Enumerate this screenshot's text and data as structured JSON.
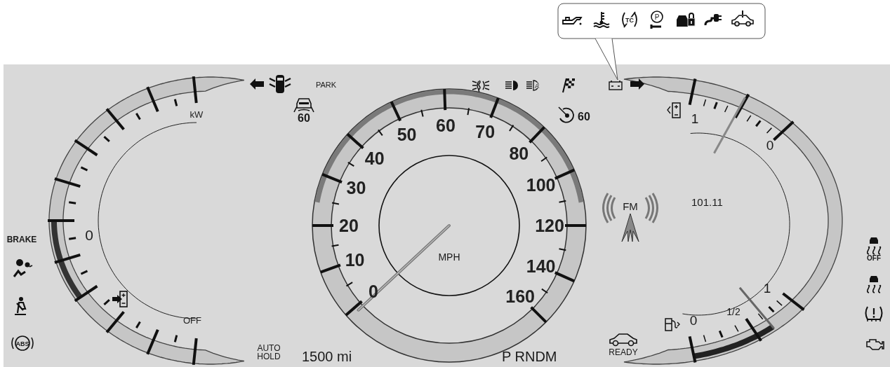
{
  "callout": {
    "icons": [
      {
        "kind": "oil_can"
      },
      {
        "kind": "coolant_temp"
      },
      {
        "kind": "tc_off",
        "text": "TC"
      },
      {
        "kind": "park_service",
        "text": "P"
      },
      {
        "kind": "locked_car"
      },
      {
        "kind": "charge_plug"
      },
      {
        "kind": "car_alert"
      }
    ]
  },
  "indicators": [
    {
      "kind": "arrow_left"
    },
    {
      "kind": "door_ajar"
    },
    {
      "kind": "text",
      "text": "PARK"
    },
    {
      "kind": "cruise_car",
      "text": "60"
    },
    {
      "kind": "fog_lamp"
    },
    {
      "kind": "low_beam"
    },
    {
      "kind": "auto_beam",
      "text": "A"
    },
    {
      "kind": "flag"
    },
    {
      "kind": "battery"
    },
    {
      "kind": "arrow_right"
    },
    {
      "kind": "speed_limiter",
      "text": "60"
    },
    {
      "kind": "bold_text",
      "text": "BRAKE"
    },
    {
      "kind": "airbag"
    },
    {
      "kind": "seatbelt"
    },
    {
      "kind": "abs",
      "text": "ABS"
    },
    {
      "kind": "lines",
      "lines": [
        "AUTO",
        "HOLD"
      ]
    },
    {
      "kind": "odometer",
      "text": "1500 mi"
    },
    {
      "kind": "gear",
      "text": "P RNDM"
    },
    {
      "kind": "car_ready",
      "text": "READY"
    },
    {
      "kind": "radio",
      "band": "FM",
      "text": "101.11"
    },
    {
      "kind": "traction_off",
      "text": "OFF"
    },
    {
      "kind": "traction"
    },
    {
      "kind": "tpms"
    },
    {
      "kind": "engine"
    }
  ],
  "power_gauge": {
    "labels": [
      "kW",
      "0",
      "OFF"
    ],
    "level": 0.4
  },
  "speedometer": {
    "left_labels": [
      "50",
      "40",
      "30",
      "20",
      "10",
      "0"
    ],
    "right_labels": [
      "60",
      "70",
      "80",
      "100",
      "120",
      "140",
      "160"
    ],
    "unit": "MPH"
  },
  "energy_gauge": {
    "labels": [
      "1",
      "0"
    ]
  },
  "fuel_gauge": {
    "labels": [
      "0",
      "1/2",
      "1"
    ]
  }
}
